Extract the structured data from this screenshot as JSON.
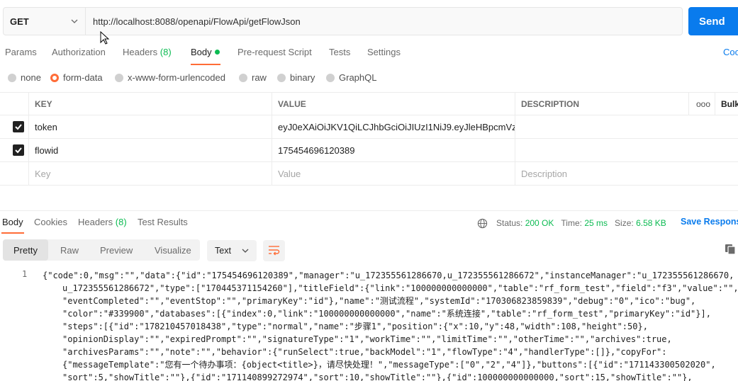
{
  "request": {
    "method": "GET",
    "url": "http://localhost:8088/openapi/FlowApi/getFlowJson",
    "send_label": "Send"
  },
  "req_tabs": [
    {
      "label": "Params"
    },
    {
      "label": "Authorization"
    },
    {
      "label": "Headers",
      "count": "(8)"
    },
    {
      "label": "Body"
    },
    {
      "label": "Pre-request Script"
    },
    {
      "label": "Tests"
    },
    {
      "label": "Settings"
    }
  ],
  "cookies_label": "Coo",
  "body_types": [
    "none",
    "form-data",
    "x-www-form-urlencoded",
    "raw",
    "binary",
    "GraphQL"
  ],
  "selected_body_type": "form-data",
  "params_table": {
    "headers": {
      "key": "KEY",
      "value": "VALUE",
      "description": "DESCRIPTION",
      "more": "ooo",
      "bulk": "Bulk"
    },
    "rows": [
      {
        "key": "token",
        "value": "eyJ0eXAiOiJKV1QiLCJhbGciOiJIUzI1NiJ9.eyJleHBpcmVz...",
        "checked": true
      },
      {
        "key": "flowid",
        "value": "175454696120389",
        "checked": true
      }
    ],
    "placeholder": {
      "key": "Key",
      "value": "Value",
      "description": "Description"
    }
  },
  "resp_tabs": [
    {
      "label": "Body"
    },
    {
      "label": "Cookies"
    },
    {
      "label": "Headers",
      "count": "(8)"
    },
    {
      "label": "Test Results"
    }
  ],
  "response_status": {
    "status_label": "Status:",
    "status_value": "200 OK",
    "time_label": "Time:",
    "time_value": "25 ms",
    "size_label": "Size:",
    "size_value": "6.58 KB",
    "save_label": "Save Respons"
  },
  "view_modes": [
    "Pretty",
    "Raw",
    "Preview",
    "Visualize"
  ],
  "format_select": "Text",
  "code": {
    "line_number": "1",
    "lines": [
      "{\"code\":0,\"msg\":\"\",\"data\":{\"id\":\"175454696120389\",\"manager\":\"u_172355561286670,u_172355561286672\",\"instanceManager\":\"u_172355561286670,",
      "u_172355561286672\",\"type\":[\"170445371154260\"],\"titleField\":{\"link\":\"100000000000000\",\"table\":\"rf_form_test\",\"field\":\"f3\",\"value\":\"\",",
      "\"eventCompleted\":\"\",\"eventStop\":\"\",\"primaryKey\":\"id\"},\"name\":\"测试流程\",\"systemId\":\"170306823859839\",\"debug\":\"0\",\"ico\":\"bug\",",
      "\"color\":\"#339900\",\"databases\":[{\"index\":0,\"link\":\"100000000000000\",\"name\":\"系统连接\",\"table\":\"rf_form_test\",\"primaryKey\":\"id\"}],",
      "\"steps\":[{\"id\":\"178210457018438\",\"type\":\"normal\",\"name\":\"步骤1\",\"position\":{\"x\":10,\"y\":48,\"width\":108,\"height\":50},",
      "\"opinionDisplay\":\"\",\"expiredPrompt\":\"\",\"signatureType\":\"1\",\"workTime\":\"\",\"limitTime\":\"\",\"otherTime\":\"\",\"archives\":true,",
      "\"archivesParams\":\"\",\"note\":\"\",\"behavior\":{\"runSelect\":true,\"backModel\":\"1\",\"flowType\":\"4\",\"handlerType\":[]},\"copyFor\":",
      "{\"messageTemplate\":\"您有一个待办事项：{object<title>}，请尽快处理！\",\"messageType\":[\"0\",\"2\",\"4\"]},\"buttons\":[{\"id\":\"171143300502020\",",
      "\"sort\":5,\"showTitle\":\"\"},{\"id\":\"171140899272974\",\"sort\":10,\"showTitle\":\"\"},{\"id\":100000000000000,\"sort\":15,\"showTitle\":\"\"},"
    ]
  }
}
